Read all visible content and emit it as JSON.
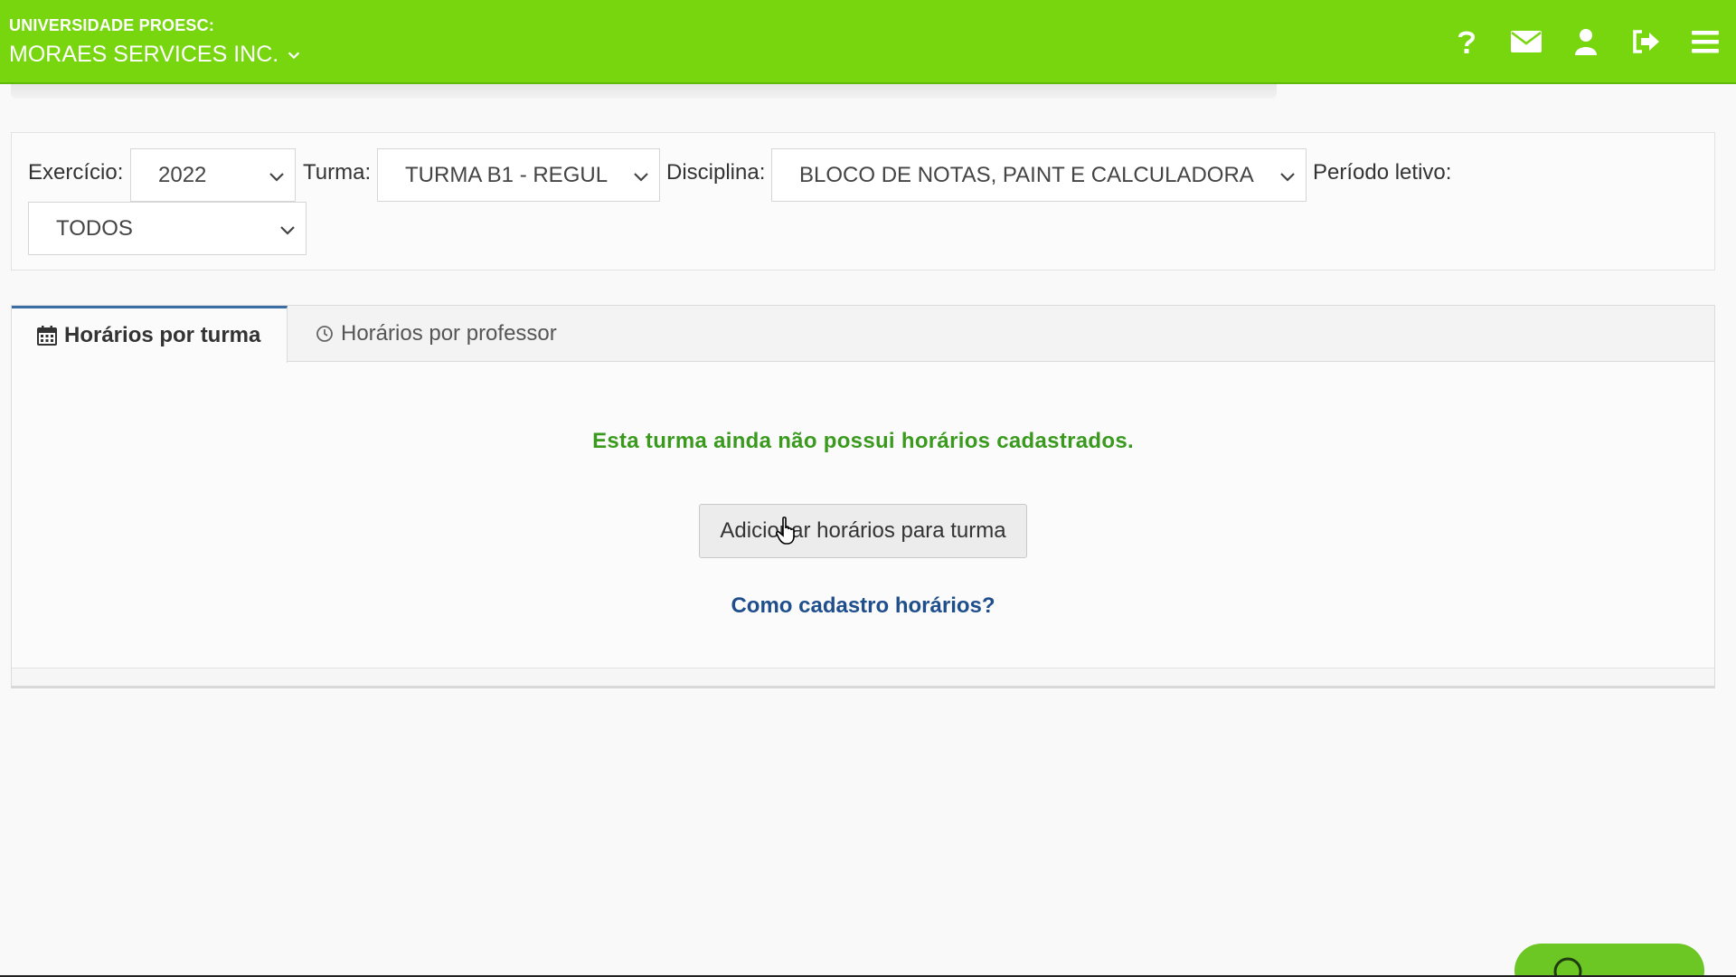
{
  "header": {
    "org_label": "UNIVERSIDADE PROESC:",
    "company_name": "MORAES SERVICES INC.",
    "background_color": "#77d60e",
    "icons": [
      "question-icon",
      "envelope-icon",
      "user-icon",
      "sign-out-icon",
      "menu-icon"
    ]
  },
  "filters": {
    "exercicio_label": "Exercício:",
    "exercicio_value": "2022",
    "turma_label": "Turma:",
    "turma_value": "TURMA B1 - REGUL",
    "disciplina_label": "Disciplina:",
    "disciplina_value": "BLOCO DE NOTAS, PAINT E CALCULADORA",
    "periodo_label": "Período letivo:",
    "periodo_value": "TODOS"
  },
  "tabs": [
    {
      "label": "Horários por turma",
      "icon": "calendar-icon",
      "active": true
    },
    {
      "label": "Horários por professor",
      "icon": "clock-icon",
      "active": false
    }
  ],
  "content": {
    "empty_message": "Esta turma ainda não possui horários cadastrados.",
    "add_button_label": "Adicionar horários para turma",
    "help_link_label": "Como cadastro horários?",
    "message_color": "#3a9a1e",
    "link_color": "#1f4e8c"
  },
  "floating_help": {
    "icon": "chat-help-icon"
  }
}
